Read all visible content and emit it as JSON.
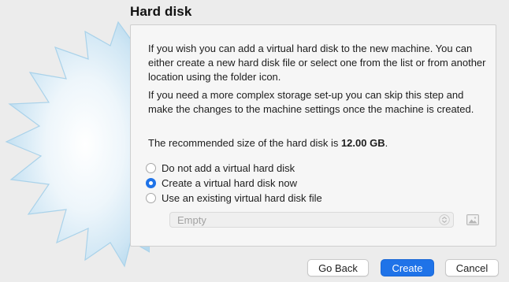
{
  "page": {
    "title": "Hard disk"
  },
  "panel": {
    "para1": "If you wish you can add a virtual hard disk to the new machine. You can either create a new hard disk file or select one from the list or from another location using the folder icon.",
    "para2": "If you need a more complex storage set-up you can skip this step and make the changes to the machine settings once the machine is created.",
    "recommended_prefix": "The recommended size of the hard disk is ",
    "recommended_size": "12.00 GB",
    "recommended_suffix": "."
  },
  "options": [
    {
      "label": "Do not add a virtual hard disk",
      "checked": false
    },
    {
      "label": "Create a virtual hard disk now",
      "checked": true
    },
    {
      "label": "Use an existing virtual hard disk file",
      "checked": false
    }
  ],
  "disk_select": {
    "value": "Empty",
    "enabled": false
  },
  "icons": {
    "combo_arrows": "chevron-up-down-icon",
    "folder": "folder-image-icon"
  },
  "buttons": {
    "back": "Go Back",
    "create": "Create",
    "cancel": "Cancel"
  },
  "colors": {
    "accent": "#1f73e8",
    "background": "#ececec",
    "panel": "#f6f6f6"
  }
}
